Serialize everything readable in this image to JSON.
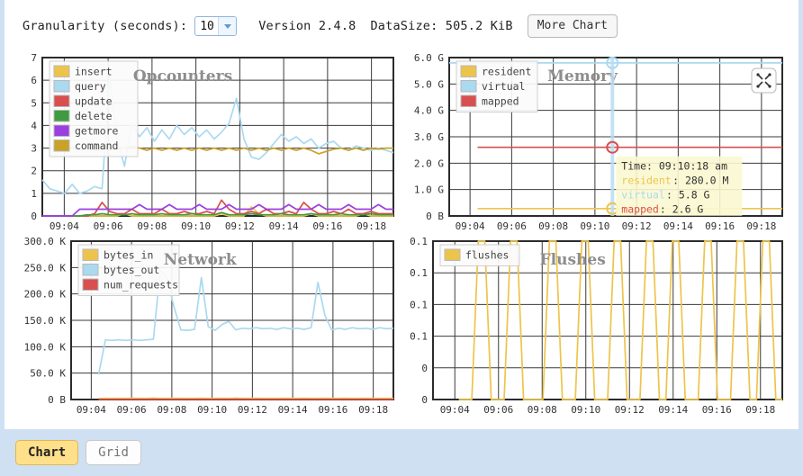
{
  "toolbar": {
    "granularity_label": "Granularity (seconds):",
    "granularity_value": "10",
    "granularity_icon": "chevron-down-icon",
    "version_label": "Version 2.4.8",
    "datasize_label": "DataSize: 505.2 KiB",
    "more_chart_label": "More Chart"
  },
  "footer": {
    "tabs": [
      {
        "label": "Chart",
        "active": true
      },
      {
        "label": "Grid",
        "active": false
      }
    ]
  },
  "colors": {
    "insert": "#edc44b",
    "query": "#aad9f0",
    "update": "#d94f4f",
    "delete": "#3f9b3f",
    "getmore": "#9b3fe0",
    "command": "#c9a227",
    "resident": "#edc44b",
    "virtual": "#aad9f0",
    "mapped": "#d94f4f",
    "bytes_in": "#edc44b",
    "bytes_out": "#aad9f0",
    "num_requests": "#d94f4f",
    "flushes": "#edc44b",
    "grid": "#3a3a3a",
    "tooltip_bg": "#fbf8d0",
    "page_bg": "#cfe0f2",
    "accent": "#ffe08a"
  },
  "tooltip": {
    "visible": true,
    "time_label": "Time: 09:10:18 am",
    "rows": [
      {
        "name": "resident",
        "value": ": 280.0 M",
        "color": "#edc44b"
      },
      {
        "name": "virtual",
        "value": ": 5.8 G",
        "color": "#aad9f0"
      },
      {
        "name": "mapped",
        "value": ": 2.6 G",
        "color": "#d94f4f"
      }
    ]
  },
  "memory_expand_icon": "expand-fullscreen-icon",
  "chart_data": [
    {
      "id": "opcounters",
      "type": "line",
      "title": "Opcounters",
      "xlabel": "",
      "ylabel": "",
      "grid": true,
      "legend_position": "top-left",
      "xticks": [
        "09:04",
        "09:06",
        "09:08",
        "09:10",
        "09:12",
        "09:14",
        "09:16",
        "09:18"
      ],
      "yticks": [
        "0",
        "1",
        "2",
        "3",
        "4",
        "5",
        "6",
        "7"
      ],
      "ylim": [
        0,
        7
      ],
      "legend": [
        "insert",
        "query",
        "update",
        "delete",
        "getmore",
        "command"
      ],
      "series": [
        {
          "name": "insert",
          "color": "#edc44b",
          "values": [
            0,
            0,
            0,
            0,
            0,
            0,
            0,
            0,
            0,
            0,
            0,
            0.1,
            0,
            0,
            0,
            0,
            0,
            0,
            0,
            0,
            0,
            0,
            0,
            0,
            0.1,
            0,
            0,
            0,
            0.4,
            0.1,
            0,
            0,
            0,
            0,
            0,
            0,
            0.1,
            0,
            0,
            0,
            0,
            0,
            0,
            0.1,
            0,
            0,
            0,
            0
          ]
        },
        {
          "name": "query",
          "color": "#aad9f0",
          "values": [
            1.6,
            1.2,
            1.1,
            1.0,
            1.4,
            1.0,
            1.1,
            1.3,
            1.2,
            6.2,
            3.4,
            2.2,
            4.1,
            3.5,
            3.9,
            3.3,
            3.8,
            3.4,
            4.0,
            3.6,
            3.9,
            3.5,
            3.8,
            3.4,
            3.7,
            4.1,
            5.2,
            3.4,
            2.6,
            2.5,
            2.8,
            3.2,
            3.6,
            3.3,
            3.5,
            3.2,
            3.4,
            3.0,
            3.2,
            3.3,
            3.0,
            2.9,
            3.1,
            3.0,
            2.9,
            3.0,
            2.9,
            2.8
          ]
        },
        {
          "name": "update",
          "color": "#d94f4f",
          "values": [
            0,
            0,
            0,
            0,
            0,
            0,
            0,
            0.1,
            0.6,
            0.2,
            0.1,
            0.1,
            0.3,
            0.1,
            0.1,
            0.1,
            0.3,
            0.1,
            0.1,
            0.2,
            0.1,
            0.1,
            0.2,
            0.1,
            0.7,
            0.3,
            0.1,
            0.1,
            0.2,
            0.1,
            0.3,
            0.1,
            0.1,
            0.2,
            0.1,
            0.6,
            0.3,
            0.1,
            0.1,
            0.2,
            0.1,
            0.3,
            0.1,
            0.1,
            0.2,
            0.1,
            0.1,
            0.1
          ]
        },
        {
          "name": "delete",
          "color": "#3f9b3f",
          "values": [
            0,
            0,
            0,
            0,
            0,
            0,
            0.05,
            0.05,
            0.1,
            0.05,
            0.05,
            0.05,
            0.1,
            0.05,
            0.05,
            0.05,
            0.1,
            0.05,
            0.05,
            0.05,
            0.1,
            0.05,
            0.05,
            0.05,
            0.15,
            0.05,
            0.05,
            0.05,
            0.1,
            0.05,
            0.05,
            0.05,
            0.1,
            0.05,
            0.05,
            0.05,
            0.1,
            0.05,
            0.05,
            0.05,
            0.1,
            0.05,
            0.05,
            0.05,
            0.1,
            0.05,
            0.05,
            0.05
          ]
        },
        {
          "name": "getmore",
          "color": "#9b3fe0",
          "values": [
            0,
            0,
            0,
            0,
            0,
            0.3,
            0.3,
            0.3,
            0.3,
            0.3,
            0.3,
            0.3,
            0.3,
            0.5,
            0.3,
            0.3,
            0.3,
            0.5,
            0.3,
            0.3,
            0.3,
            0.5,
            0.3,
            0.3,
            0.3,
            0.5,
            0.3,
            0.3,
            0.3,
            0.5,
            0.3,
            0.3,
            0.3,
            0.5,
            0.3,
            0.3,
            0.3,
            0.5,
            0.3,
            0.3,
            0.3,
            0.5,
            0.3,
            0.3,
            0.3,
            0.5,
            0.3,
            0.3
          ]
        },
        {
          "name": "command",
          "color": "#c9a227",
          "values": [
            null,
            null,
            null,
            null,
            null,
            2.9,
            3.0,
            2.9,
            3.0,
            2.9,
            3.0,
            3.0,
            3.1,
            3.0,
            2.9,
            3.0,
            2.9,
            3.0,
            2.9,
            3.0,
            2.9,
            3.0,
            2.9,
            3.0,
            2.9,
            3.0,
            2.9,
            3.0,
            2.9,
            3.0,
            2.9,
            3.0,
            2.9,
            3.0,
            2.9,
            3.0,
            2.9,
            2.75,
            2.85,
            2.95,
            3.0,
            2.9,
            3.0,
            2.9,
            3.0,
            2.95,
            3.0,
            3.0
          ]
        }
      ]
    },
    {
      "id": "memory",
      "type": "line",
      "title": "Memory",
      "xlabel": "",
      "ylabel": "",
      "grid": true,
      "legend_position": "top-left",
      "xticks": [
        "09:04",
        "09:06",
        "09:08",
        "09:10",
        "09:12",
        "09:14",
        "09:16",
        "09:18"
      ],
      "yticks": [
        "0 B",
        "1.0 G",
        "2.0 G",
        "3.0 G",
        "4.0 G",
        "5.0 G",
        "6.0 G"
      ],
      "ylim": [
        0,
        6
      ],
      "legend": [
        "resident",
        "virtual",
        "mapped"
      ],
      "series": [
        {
          "name": "resident",
          "color": "#edc44b",
          "unit": "G",
          "values": [
            null,
            null,
            null,
            null,
            0.28,
            0.28,
            0.28,
            0.28,
            0.28,
            0.28,
            0.28,
            0.28,
            0.28,
            0.28,
            0.28,
            0.28,
            0.28,
            0.28,
            0.28,
            0.28,
            0.28,
            0.28,
            0.28,
            0.28,
            0.28,
            0.28,
            0.28,
            0.28,
            0.28,
            0.28,
            0.28,
            0.28,
            0.28,
            0.28,
            0.28,
            0.28,
            0.28,
            0.28,
            0.28,
            0.28,
            0.28,
            0.28,
            0.28,
            0.28,
            0.28,
            0.28,
            0.28,
            0.28
          ]
        },
        {
          "name": "virtual",
          "color": "#aad9f0",
          "unit": "G",
          "values": [
            5.8,
            5.8,
            5.8,
            5.8,
            5.8,
            5.8,
            5.8,
            5.8,
            5.8,
            5.8,
            5.8,
            5.8,
            5.8,
            5.8,
            5.8,
            5.8,
            5.8,
            5.8,
            5.8,
            5.8,
            5.8,
            5.8,
            5.8,
            5.8,
            5.8,
            5.8,
            5.8,
            5.8,
            5.8,
            5.8,
            5.8,
            5.8,
            5.8,
            5.8,
            5.8,
            5.8,
            5.8,
            5.8,
            5.8,
            5.8,
            5.8,
            5.8,
            5.8,
            5.8,
            5.8,
            5.8,
            5.8,
            5.8
          ]
        },
        {
          "name": "mapped",
          "color": "#d94f4f",
          "unit": "G",
          "values": [
            null,
            null,
            null,
            null,
            2.6,
            2.6,
            2.6,
            2.6,
            2.6,
            2.6,
            2.6,
            2.6,
            2.6,
            2.6,
            2.6,
            2.6,
            2.6,
            2.6,
            2.6,
            2.6,
            2.6,
            2.6,
            2.6,
            2.6,
            2.6,
            2.6,
            2.6,
            2.6,
            2.6,
            2.6,
            2.6,
            2.6,
            2.6,
            2.6,
            2.6,
            2.6,
            2.6,
            2.6,
            2.6,
            2.6,
            2.6,
            2.6,
            2.6,
            2.6,
            2.6,
            2.6,
            2.6,
            2.6
          ]
        }
      ],
      "cursor": {
        "x_index": 24,
        "time": "09:10:18 am"
      }
    },
    {
      "id": "network",
      "type": "line",
      "title": "Network",
      "xlabel": "",
      "ylabel": "",
      "grid": true,
      "legend_position": "top-left",
      "xticks": [
        "09:04",
        "09:06",
        "09:08",
        "09:10",
        "09:12",
        "09:14",
        "09:16",
        "09:18"
      ],
      "yticks": [
        "0 B",
        "50.0 K",
        "100.0 K",
        "150.0 K",
        "200.0 K",
        "250.0 K",
        "300.0 K"
      ],
      "ylim": [
        0,
        300000
      ],
      "legend": [
        "bytes_in",
        "bytes_out",
        "num_requests"
      ],
      "series": [
        {
          "name": "bytes_in",
          "color": "#edc44b",
          "values": [
            null,
            null,
            null,
            null,
            2000,
            2200,
            2100,
            2300,
            2200,
            2400,
            2300,
            2200,
            2500,
            2300,
            2200,
            2400,
            2300,
            2200,
            2300,
            2400,
            2200,
            2300,
            2400,
            2200,
            2600,
            2300,
            2200,
            2400,
            2300,
            2200,
            2300,
            2400,
            2200,
            2300,
            2400,
            2200,
            2300,
            2400,
            2300,
            2200,
            2400,
            2300,
            2200,
            2400,
            2300,
            2200,
            2300,
            2300
          ]
        },
        {
          "name": "bytes_out",
          "color": "#aad9f0",
          "values": [
            null,
            null,
            null,
            null,
            47000,
            113000,
            112000,
            113000,
            112000,
            113000,
            112000,
            113000,
            114000,
            245000,
            230000,
            175000,
            132000,
            131000,
            133000,
            231000,
            138000,
            131000,
            142000,
            148000,
            132000,
            135000,
            134000,
            136000,
            134000,
            135000,
            133000,
            136000,
            134000,
            135000,
            133000,
            136000,
            222000,
            160000,
            132000,
            135000,
            133000,
            136000,
            134000,
            135000,
            133000,
            136000,
            134000,
            135000
          ]
        },
        {
          "name": "num_requests",
          "color": "#d94f4f",
          "values": [
            null,
            null,
            null,
            null,
            300,
            400,
            350,
            400,
            350,
            400,
            350,
            400,
            450,
            400,
            350,
            400,
            350,
            400,
            350,
            400,
            350,
            400,
            350,
            400,
            500,
            400,
            350,
            400,
            350,
            400,
            350,
            400,
            350,
            400,
            350,
            400,
            350,
            400,
            350,
            400,
            350,
            400,
            350,
            400,
            350,
            400,
            350,
            350
          ]
        }
      ]
    },
    {
      "id": "flushes",
      "type": "line",
      "title": "Flushes",
      "xlabel": "",
      "ylabel": "",
      "grid": true,
      "legend_position": "top-left",
      "xticks": [
        "09:04",
        "09:06",
        "09:08",
        "09:10",
        "09:12",
        "09:14",
        "09:16",
        "09:18"
      ],
      "yticks": [
        "0",
        "0",
        "0.1",
        "0.1",
        "0.1",
        "0.1"
      ],
      "ylim": [
        0,
        0.1
      ],
      "legend": [
        "flushes"
      ],
      "series": [
        {
          "name": "flushes",
          "color": "#edc44b",
          "values": [
            null,
            null,
            null,
            null,
            0,
            0,
            0,
            0.1,
            0.1,
            0,
            0,
            0,
            0.1,
            0.1,
            0,
            0,
            0,
            0,
            0.1,
            0.1,
            0,
            0,
            0,
            0.1,
            0.1,
            0,
            0,
            0,
            0.1,
            0.1,
            0,
            0,
            0,
            0.1,
            0.1,
            0,
            0,
            0.1,
            0.1,
            0,
            0,
            0,
            0.1,
            0.1,
            0,
            0,
            0,
            0.1,
            0.1,
            0,
            0,
            0.1,
            0.1,
            0,
            0
          ]
        }
      ]
    }
  ]
}
